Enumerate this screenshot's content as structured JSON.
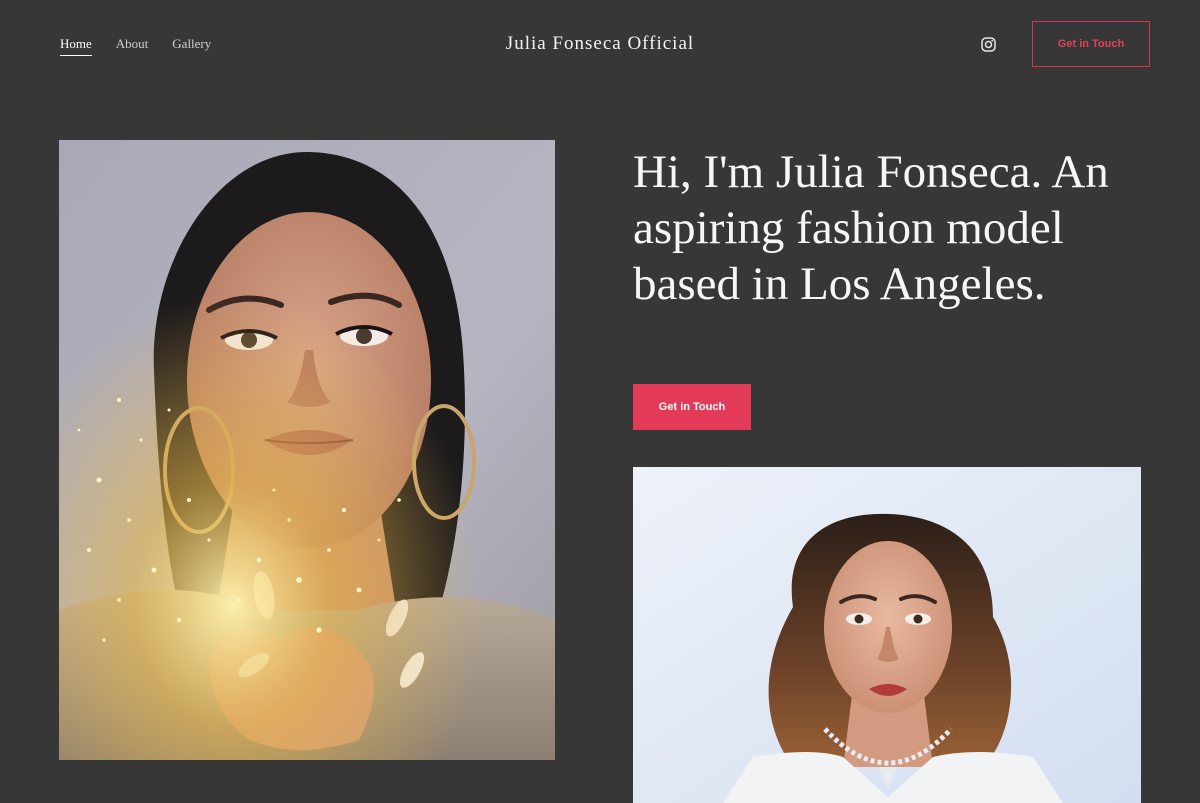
{
  "header": {
    "nav": [
      {
        "label": "Home",
        "active": true
      },
      {
        "label": "About",
        "active": false
      },
      {
        "label": "Gallery",
        "active": false
      }
    ],
    "site_title": "Julia Fonseca Official",
    "social_icon": "instagram-icon",
    "cta_label": "Get in Touch"
  },
  "hero": {
    "headline": "Hi, I'm Julia Fonseca. An aspiring fashion model based in Los Angeles.",
    "cta_label": "Get in Touch"
  },
  "colors": {
    "background": "#373737",
    "accent": "#e23a57",
    "text": "#f6f6f6"
  }
}
